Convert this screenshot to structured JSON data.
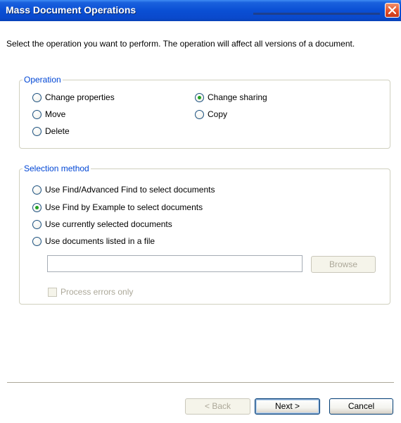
{
  "window": {
    "title": "Mass Document Operations",
    "prompt": "Select the operation you want to perform. The operation will affect all versions of a document."
  },
  "operation": {
    "legend": "Operation",
    "options": [
      {
        "label": "Change properties",
        "checked": false
      },
      {
        "label": "Change sharing",
        "checked": true
      },
      {
        "label": "Move",
        "checked": false
      },
      {
        "label": "Copy",
        "checked": false
      },
      {
        "label": "Delete",
        "checked": false
      }
    ]
  },
  "selection_method": {
    "legend": "Selection method",
    "options": [
      {
        "label": "Use Find/Advanced Find to select documents",
        "checked": false
      },
      {
        "label": "Use Find by Example to select documents",
        "checked": true
      },
      {
        "label": "Use currently selected documents",
        "checked": false
      },
      {
        "label": "Use documents listed in a file",
        "checked": false
      }
    ],
    "file_path_value": "",
    "browse_label": "Browse",
    "process_errors_label": "Process errors only",
    "process_errors_checked": false
  },
  "footer": {
    "back_label": "< Back",
    "next_label": "Next >",
    "cancel_label": "Cancel"
  },
  "colors": {
    "title_bar": "#0a4fd4",
    "legend_text": "#0046d5",
    "radio_checked": "#21a121",
    "close_button": "#e3502a"
  }
}
